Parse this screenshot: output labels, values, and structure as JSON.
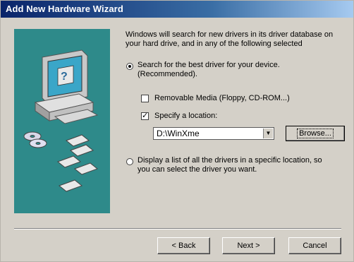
{
  "window": {
    "title": "Add New Hardware Wizard"
  },
  "content": {
    "description": "Windows will search for new drivers in its driver database on your hard drive, and in any of the following selected",
    "option_search": {
      "label": "Search for the best driver for your device.",
      "sublabel": "(Recommended).",
      "selected": true
    },
    "removable_media": {
      "label": "Removable Media (Floppy, CD-ROM...)",
      "checked": false
    },
    "specify_location": {
      "label": "Specify a location:",
      "checked": true
    },
    "location_combo": {
      "value": "D:\\WinXme"
    },
    "browse_button": "Browse...",
    "option_list": {
      "label": "Display a list of all the drivers in a specific location, so",
      "sublabel": "you can select the driver you want.",
      "selected": false
    }
  },
  "footer": {
    "back": "< Back",
    "next": "Next >",
    "cancel": "Cancel"
  },
  "icons": {
    "combo_arrow": "▼",
    "check_mark": "✓"
  },
  "colors": {
    "title_bar_start": "#0a246a",
    "dialog_face": "#d4d0c8",
    "art_background": "#2e8a8a"
  }
}
